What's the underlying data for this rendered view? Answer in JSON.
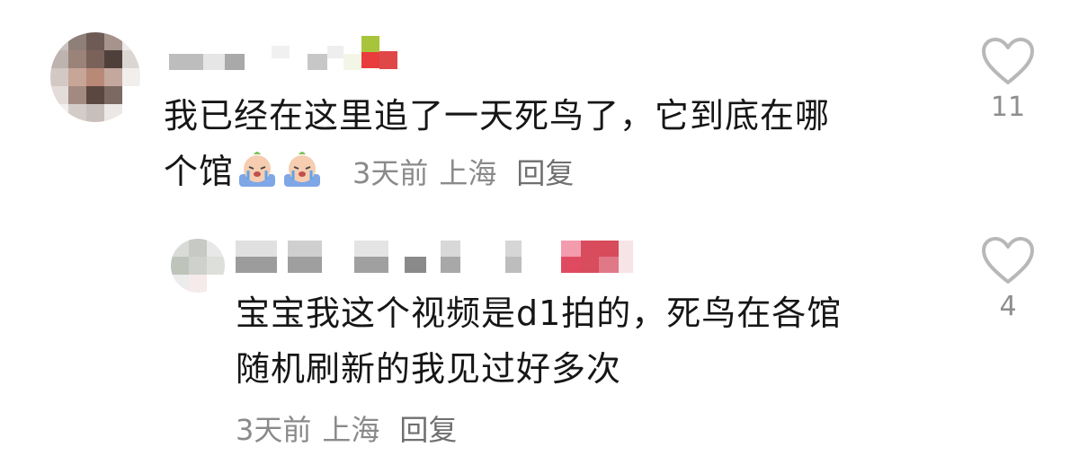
{
  "comment": {
    "text_line1": "我已经在这里追了一天死鸟了，它到底在哪",
    "text_line2": "个馆",
    "emoji_name": "crying-emoji",
    "time": "3天前",
    "location": "上海",
    "reply_label": "回复",
    "like_count": "11"
  },
  "reply": {
    "text_line1": "宝宝我这个视频是d1拍的，死鸟在各馆",
    "text_line2": "随机刷新的我见过好多次",
    "time": "3天前",
    "location": "上海",
    "reply_label": "回复",
    "like_count": "4"
  },
  "colors": {
    "heart_outline": "#b8b8b8",
    "meta_text": "#8a8a8a",
    "body_text": "#161616"
  }
}
